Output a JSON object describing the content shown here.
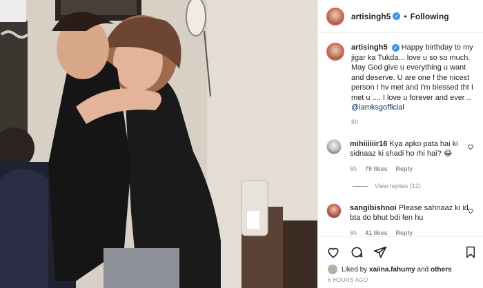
{
  "post": {
    "author": "artisingh5",
    "follow_state": "Following",
    "separator": "•",
    "verified_glyph": "✓"
  },
  "caption": {
    "author": "artisingh5",
    "text": "Happy birthday to my jigar ka Tukda... love u so so much. May God give u everything u want and deserve. U are one f the nicest person I hv met and I'm blessed tht I met u .... I love u forever and ever ..",
    "mention": "@iamksgofficial",
    "time": "6h"
  },
  "comments": [
    {
      "user": "mihiiiiiir16",
      "text": "Kya apko pata hai ki sidnaaz ki shadi ho rhi hai? 😂",
      "time": "5h",
      "likes": "79 likes",
      "reply": "Reply"
    },
    {
      "user": "sangibishnoi",
      "text": "Please sahnaaz ki id bta do bhut bdi fen hu",
      "time": "6h",
      "likes": "41 likes",
      "reply": "Reply"
    }
  ],
  "view_replies": "View replies (12)",
  "likes_bar": {
    "prefix": "Liked by",
    "user": "xaiina.fahumy",
    "conj": "and",
    "others": "others"
  },
  "timestamp": "6 HOURS AGO",
  "icons": {
    "like": "heart-icon",
    "comment": "comment-icon",
    "share": "share-icon",
    "save": "bookmark-icon"
  },
  "colors": {
    "link": "#003569",
    "meta": "#8e8e8e",
    "verified": "#3897f0"
  }
}
